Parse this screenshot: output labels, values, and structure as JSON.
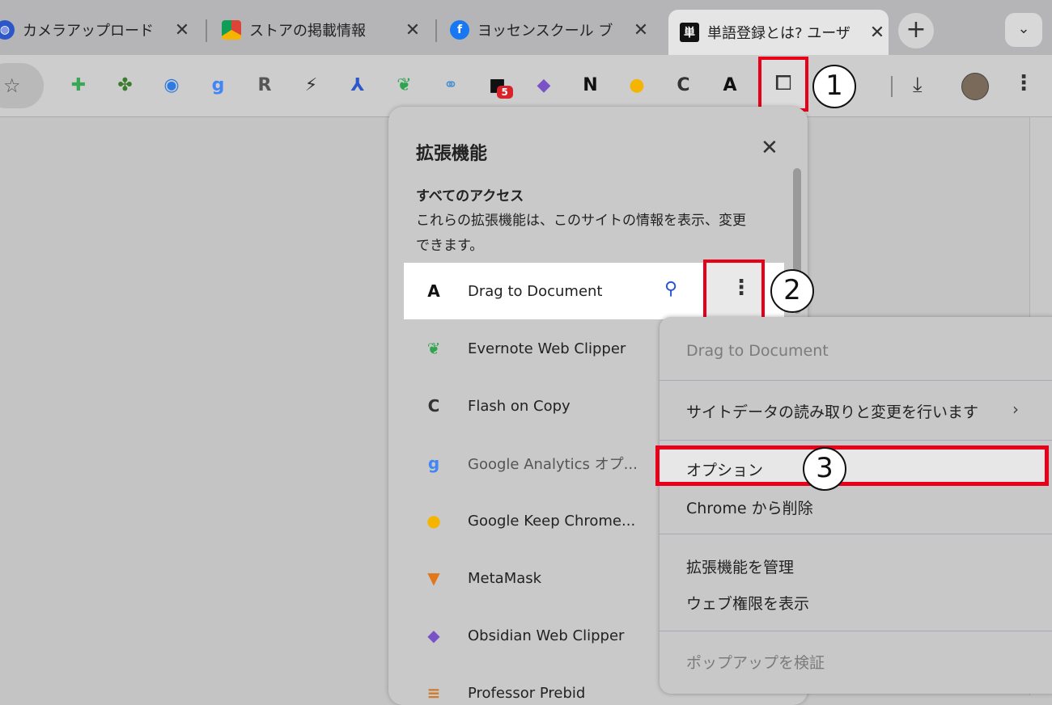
{
  "tabs": [
    {
      "title": "カメラアップロード",
      "favicon": "globe-icon",
      "active": false
    },
    {
      "title": "ストアの掲載情報",
      "favicon": "chrome-web-store-icon",
      "active": false
    },
    {
      "title": "ヨッセンスクール ブ",
      "favicon": "facebook-icon",
      "active": false
    },
    {
      "title": "単語登録とは? ユーザ",
      "favicon": "kanji-tan-icon",
      "favicon_text": "単",
      "active": true
    }
  ],
  "toolbar": {
    "new_tab": "+",
    "tab_menu": "⌄",
    "extensions": [
      {
        "name": "plus-extension-icon",
        "glyph": "✚",
        "color": "#3aa757"
      },
      {
        "name": "puzzle-extension-icon",
        "glyph": "✤",
        "color": "#3a7d2e"
      },
      {
        "name": "compass-extension-icon",
        "glyph": "◉",
        "color": "#2d7be0"
      },
      {
        "name": "google-analytics-icon",
        "glyph": "g",
        "color": "#4285f4"
      },
      {
        "name": "rakuten-icon",
        "glyph": "R",
        "color": "#555"
      },
      {
        "name": "lightning-icon",
        "glyph": "⚡",
        "color": "#333"
      },
      {
        "name": "branch-icon",
        "glyph": "⅄",
        "color": "#2d57c9"
      },
      {
        "name": "evernote-icon",
        "glyph": "❦",
        "color": "#2da44e"
      },
      {
        "name": "binoculars-icon",
        "glyph": "⚭",
        "color": "#4a8fd1"
      },
      {
        "name": "chat-badge-icon",
        "glyph": "■",
        "color": "#111",
        "badge": "5"
      },
      {
        "name": "obsidian-icon",
        "glyph": "◆",
        "color": "#7a52c7"
      },
      {
        "name": "notion-icon",
        "glyph": "N",
        "color": "#111"
      },
      {
        "name": "keep-icon",
        "glyph": "●",
        "color": "#f4b400"
      },
      {
        "name": "flash-copy-icon",
        "glyph": "C",
        "color": "#333"
      },
      {
        "name": "drag-document-icon",
        "glyph": "A",
        "color": "#111"
      }
    ]
  },
  "annotations": {
    "one": "1",
    "two": "2",
    "three": "3"
  },
  "panel": {
    "title": "拡張機能",
    "close": "✕",
    "access_heading": "すべてのアクセス",
    "access_description": "これらの拡張機能は、このサイトの情報を表示、変更できます。",
    "items": [
      {
        "name": "Drag to Document",
        "icon": "drag-document-icon",
        "glyph": "A",
        "color": "#111"
      },
      {
        "name": "Evernote Web Clipper",
        "icon": "evernote-icon",
        "glyph": "❦",
        "color": "#2da44e"
      },
      {
        "name": "Flash on Copy",
        "icon": "flash-copy-icon",
        "glyph": "C",
        "color": "#333"
      },
      {
        "name": "Google Analytics オプ...",
        "icon": "google-analytics-icon",
        "glyph": "g",
        "color": "#4285f4"
      },
      {
        "name": "Google Keep Chrome...",
        "icon": "keep-icon",
        "glyph": "●",
        "color": "#f4b400"
      },
      {
        "name": "MetaMask",
        "icon": "metamask-fox-icon",
        "glyph": "▼",
        "color": "#e2761b"
      },
      {
        "name": "Obsidian Web Clipper",
        "icon": "obsidian-icon",
        "glyph": "◆",
        "color": "#7a52c7"
      },
      {
        "name": "Professor Prebid",
        "icon": "prebid-icon",
        "glyph": "≡",
        "color": "#d07a2e"
      }
    ]
  },
  "menu": {
    "header": "Drag to Document",
    "site_data": "サイトデータの読み取りと変更を行います",
    "arrow": "›",
    "options": "オプション",
    "remove": "Chrome から削除",
    "manage": "拡張機能を管理",
    "web_permissions": "ウェブ権限を表示",
    "inspect_popup": "ポップアップを検証"
  }
}
